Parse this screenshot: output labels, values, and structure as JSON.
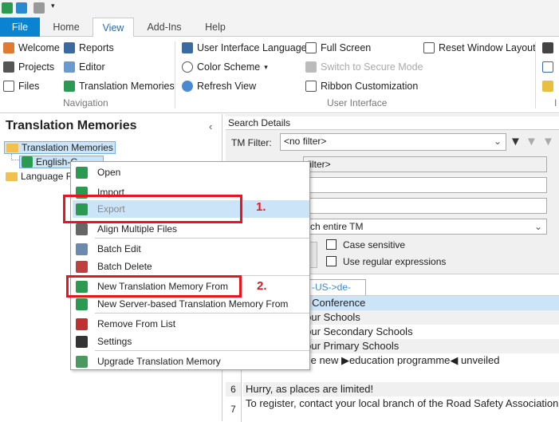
{
  "quick_access": {
    "icons": [
      "studio-app-icon",
      "sync-icon",
      "save-icon",
      "customize-dropdown-icon"
    ]
  },
  "tabs": [
    {
      "label": "File"
    },
    {
      "label": "Home"
    },
    {
      "label": "View",
      "active": true
    },
    {
      "label": "Add-Ins"
    },
    {
      "label": "Help"
    }
  ],
  "ribbon": {
    "navigation": {
      "label": "Navigation",
      "items": [
        {
          "label": "Welcome",
          "icon": "home-icon"
        },
        {
          "label": "Projects",
          "icon": "projects-icon"
        },
        {
          "label": "Files",
          "icon": "file-icon"
        },
        {
          "label": "Reports",
          "icon": "reports-icon"
        },
        {
          "label": "Editor",
          "icon": "pencil-icon"
        },
        {
          "label": "Translation Memories",
          "icon": "tm-icon"
        }
      ]
    },
    "user_interface": {
      "label": "User Interface",
      "items": [
        {
          "label": "User Interface Language",
          "icon": "language-icon"
        },
        {
          "label": "Color Scheme",
          "icon": "palette-icon"
        },
        {
          "label": "Refresh View",
          "icon": "refresh-icon"
        },
        {
          "label": "Full Screen",
          "icon": "fullscreen-icon"
        },
        {
          "label": "Switch to Secure Mode",
          "icon": "lock-icon",
          "disabled": true
        },
        {
          "label": "Ribbon Customization",
          "icon": "hierarchy-icon"
        },
        {
          "label": "Reset Window Layout",
          "icon": "reset-layout-icon"
        }
      ]
    },
    "partial_group_label": "I"
  },
  "left_panel": {
    "title": "Translation Memories",
    "tree": [
      {
        "label": "Translation Memories"
      },
      {
        "label": "English-G"
      },
      {
        "label": "Language R"
      }
    ]
  },
  "search": {
    "header": "Search Details",
    "tm_filter_label": "TM Filter:",
    "tm_filter_value": "<no filter>",
    "filter_field": "filter>",
    "scope": "rch entire TM",
    "case_sensitive": "Case sensitive",
    "regex": "Use regular expressions"
  },
  "grid": {
    "tab": "-US->de-DE]",
    "rows": [
      {
        "num": "",
        "text": "r Road Safety Conference"
      },
      {
        "num": "",
        "text": "Education in our Schools"
      },
      {
        "num": "",
        "text": "Education in our Secondary Schools"
      },
      {
        "num": "",
        "text": "Education in our Primary Schools"
      },
      {
        "num": "",
        "text": "ce presents the new ▶education programme◀ unveiled"
      },
      {
        "num": "",
        "text": ""
      },
      {
        "num": "6",
        "text": "Hurry, as places are limited!"
      },
      {
        "num": "7",
        "text": "To register, contact your local branch of the Road Safety Association"
      }
    ]
  },
  "context_menu": {
    "items": [
      {
        "label": "Open",
        "icon": "open-tm-icon"
      },
      {
        "label": "Import",
        "icon": "import-icon"
      },
      {
        "label": "Export",
        "icon": "export-icon",
        "highlighted": true
      },
      {
        "label": "Align Multiple Files",
        "icon": "align-icon"
      },
      {
        "label": "Batch Edit",
        "icon": "batch-edit-icon"
      },
      {
        "label": "Batch Delete",
        "icon": "batch-delete-icon"
      },
      {
        "label": "New Translation Memory From",
        "icon": "new-tm-icon"
      },
      {
        "label": "New Server-based Translation Memory From",
        "icon": "new-server-tm-icon"
      },
      {
        "label": "Remove From List",
        "icon": "remove-icon"
      },
      {
        "label": "Settings",
        "icon": "gear-icon"
      },
      {
        "label": "Upgrade Translation Memory",
        "icon": "upgrade-icon"
      }
    ]
  },
  "annotations": {
    "step1": "1.",
    "step2": "2.",
    "color": "#e8141e"
  },
  "colors": {
    "accent": "#0a84d0",
    "highlight": "#cce4f7",
    "tag": "#800080"
  }
}
